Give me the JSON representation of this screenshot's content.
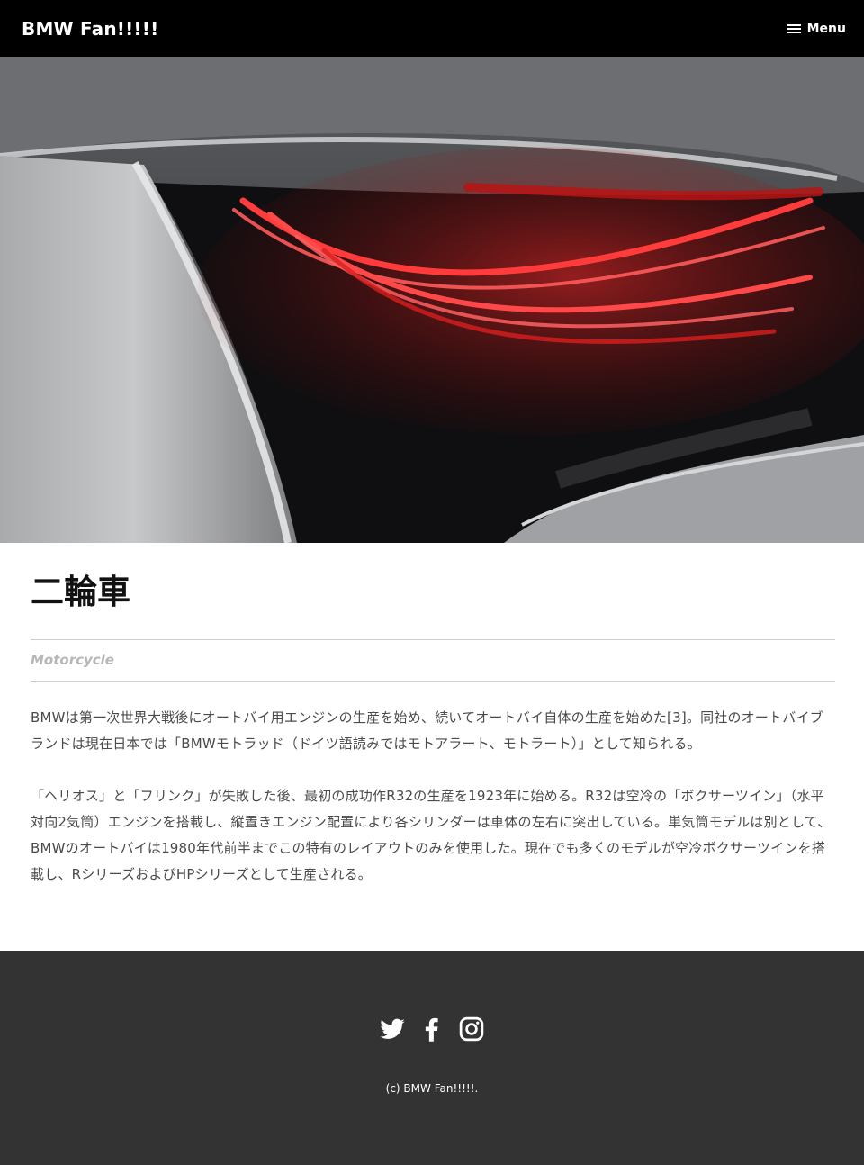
{
  "header": {
    "site_title": "BMW Fan!!!!!",
    "menu_label": "Menu"
  },
  "hero": {
    "image_subject": "BMW rear tail light (red LED)"
  },
  "article": {
    "title": "二輪車",
    "subtitle": "Motorcycle",
    "paragraphs": [
      "BMWは第一次世界大戦後にオートバイ用エンジンの生産を始め、続いてオートバイ自体の生産を始めた[3]。同社のオートバイブランドは現在日本では「BMWモトラッド（ドイツ語読みではモトアラート、モトラート）」として知られる。",
      "「ヘリオス」と「フリンク」が失敗した後、最初の成功作R32の生産を1923年に始める。R32は空冷の「ボクサーツイン」（水平対向2気筒）エンジンを搭載し、縦置きエンジン配置により各シリンダーは車体の左右に突出している。単気筒モデルは別として、BMWのオートバイは1980年代前半までこの特有のレイアウトのみを使用した。現在でも多くのモデルが空冷ボクサーツインを搭載し、RシリーズおよびHPシリーズとして生産される。"
    ]
  },
  "footer": {
    "social": [
      {
        "icon": "twitter-icon"
      },
      {
        "icon": "facebook-icon"
      },
      {
        "icon": "instagram-icon"
      }
    ],
    "copyright": "(c) BMW Fan!!!!!."
  },
  "colors": {
    "header_bg": "#000000",
    "footer_bg": "#333333",
    "subtitle": "#b7b7b7",
    "body_text": "#4a4a4a"
  }
}
